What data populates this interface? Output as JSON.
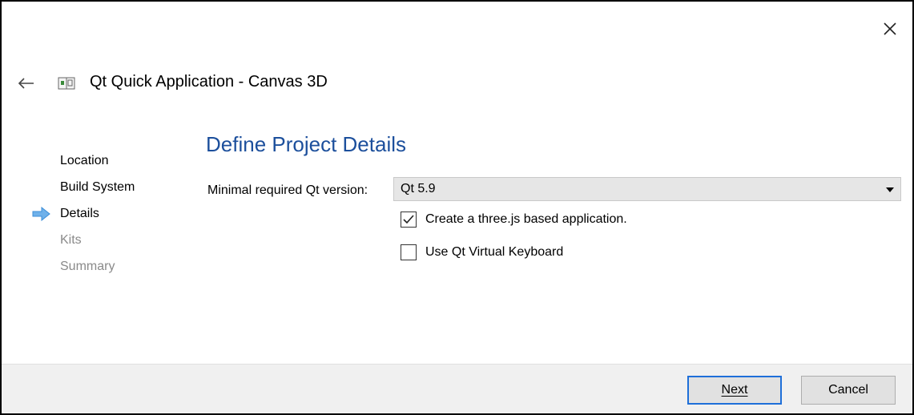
{
  "window": {
    "title": "Qt Quick Application - Canvas 3D",
    "icons": {
      "close": "close-icon",
      "back": "back-arrow-icon",
      "app": "qt-app-icon"
    }
  },
  "steps": [
    {
      "label": "Location",
      "state": "done"
    },
    {
      "label": "Build System",
      "state": "done"
    },
    {
      "label": "Details",
      "state": "current"
    },
    {
      "label": "Kits",
      "state": "pending"
    },
    {
      "label": "Summary",
      "state": "pending"
    }
  ],
  "page": {
    "title": "Define Project Details",
    "qt_version_label": "Minimal required Qt version:",
    "qt_version_value": "Qt 5.9",
    "option_threejs": {
      "label": "Create a three.js based application.",
      "checked": true
    },
    "option_keyboard": {
      "label": "Use Qt Virtual Keyboard",
      "checked": false
    }
  },
  "footer": {
    "next_label": "Next",
    "cancel_label": "Cancel"
  },
  "colors": {
    "title_blue": "#1c4f9c",
    "step_arrow": "#3c8ed8",
    "primary_border": "#1e6fd9",
    "pending_text": "#8a8a8a"
  }
}
